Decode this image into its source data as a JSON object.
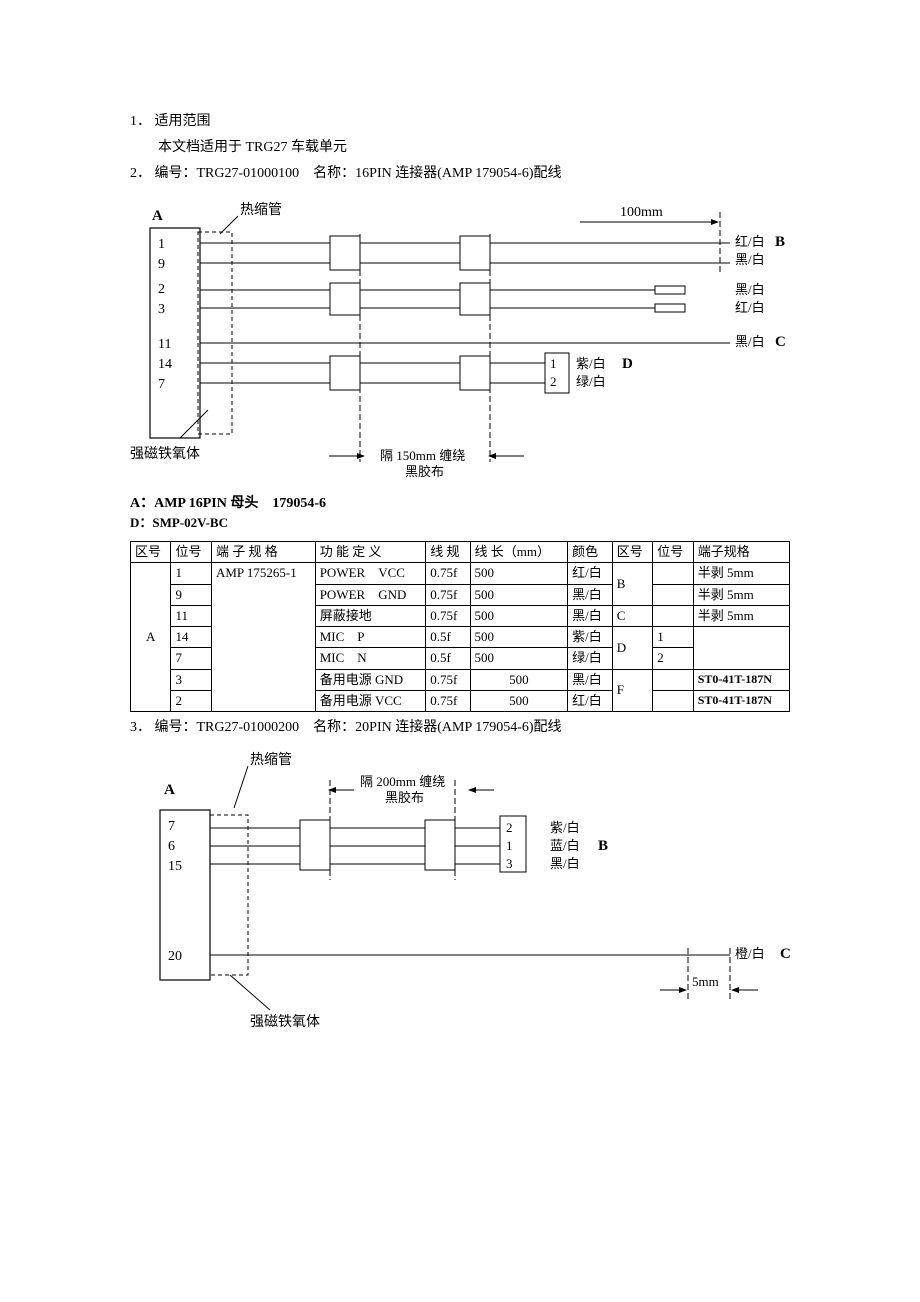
{
  "section1": {
    "num": "1．",
    "title": "适用范围",
    "body": "本文档适用于 TRG27 车载单元"
  },
  "section2": {
    "num": "2．",
    "title": "编号：TRG27-01000100　名称：16PIN 连接器(AMP 179054-6)配线"
  },
  "diagram1": {
    "A": "A",
    "heat_shrink": "热缩管",
    "ferrite": "强磁铁氧体",
    "len100": "100mm",
    "tape": "隔 150mm 缠绕",
    "tape2": "黑胶布",
    "pins": {
      "p1": "1",
      "p9": "9",
      "p2": "2",
      "p3": "3",
      "p11": "11",
      "p14": "14",
      "p7": "7"
    },
    "d_pins": {
      "d1": "1",
      "d2": "2"
    },
    "colors": {
      "red_white": "红/白",
      "black_white": "黑/白",
      "purple_white": "紫/白",
      "green_white": "绿/白"
    },
    "B": "B",
    "C": "C",
    "D": "D"
  },
  "labels_after_d1": {
    "lineA": "A：AMP 16PIN 母头　179054-6",
    "lineD": "D：SMP-02V-BC"
  },
  "table_headers": {
    "zone": "区号",
    "pos": "位号",
    "terminal": "端 子 规 格",
    "func": "功 能 定 义",
    "gauge": "线 规",
    "length": "线 长（mm）",
    "color": "颜色",
    "zone2": "区号",
    "pos2": "位号",
    "terminal2": "端子规格"
  },
  "rows": [
    {
      "pos": "1",
      "term": "AMP 175265-1",
      "func": "POWER　VCC",
      "gauge": "0.75f",
      "len": "500",
      "color": "红/白",
      "zone2": "B",
      "pos2": "",
      "term2": "半剥 5mm"
    },
    {
      "pos": "9",
      "term": "",
      "func": "POWER　GND",
      "gauge": "0.75f",
      "len": "500",
      "color": "黑/白",
      "zone2": "",
      "pos2": "",
      "term2": "半剥 5mm"
    },
    {
      "pos": "11",
      "term": "",
      "func": "屏蔽接地",
      "gauge": "0.75f",
      "len": "500",
      "color": "黑/白",
      "zone2": "C",
      "pos2": "",
      "term2": "半剥 5mm"
    },
    {
      "pos": "14",
      "term": "",
      "func": "MIC　P",
      "gauge": "0.5f",
      "len": "500",
      "color": "紫/白",
      "zone2": "D",
      "pos2": "1",
      "term2": ""
    },
    {
      "pos": "7",
      "term": "",
      "func": "MIC　N",
      "gauge": "0.5f",
      "len": "500",
      "color": "绿/白",
      "zone2": "",
      "pos2": "2",
      "term2": ""
    },
    {
      "pos": "3",
      "term": "",
      "func": "备用电源 GND",
      "gauge": "0.75f",
      "len": "500",
      "color": "黑/白",
      "zone2": "F",
      "pos2": "",
      "term2": "ST0-41T-187N"
    },
    {
      "pos": "2",
      "term": "",
      "func": "备用电源 VCC",
      "gauge": "0.75f",
      "len": "500",
      "color": "红/白",
      "zone2": "",
      "pos2": "",
      "term2": "ST0-41T-187N"
    }
  ],
  "zoneA": "A",
  "section3": {
    "num": "3．",
    "title": "编号：TRG27-01000200　名称：20PIN 连接器(AMP 179054-6)配线"
  },
  "diagram2": {
    "A": "A",
    "heat_shrink": "热缩管",
    "tape": "隔 200mm 缠绕",
    "tape2": "黑胶布",
    "ferrite": "强磁铁氧体",
    "pins": {
      "p7": "7",
      "p6": "6",
      "p15": "15",
      "p20": "20"
    },
    "b_pins": {
      "b2": "2",
      "b1": "1",
      "b3": "3"
    },
    "colors": {
      "purple_white": "紫/白",
      "blue_white": "蓝/白",
      "black_white": "黑/白",
      "orange_white": "橙/白"
    },
    "B": "B",
    "C": "C",
    "len5": "5mm"
  }
}
